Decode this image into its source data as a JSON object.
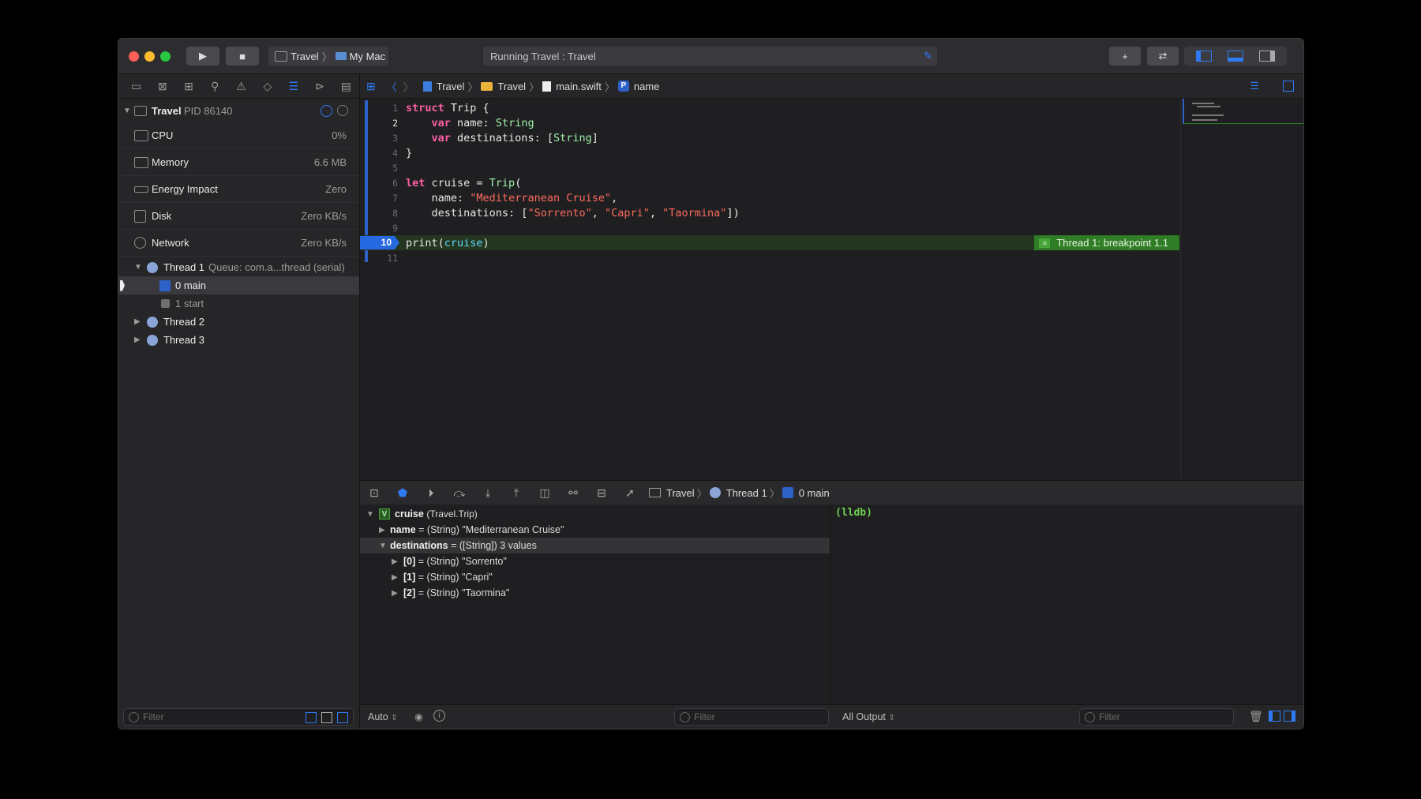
{
  "toolbar": {
    "scheme_project": "Travel",
    "scheme_destination": "My Mac",
    "status": "Running Travel : Travel"
  },
  "navigator": {
    "process_name": "Travel",
    "process_pid": "PID 86140",
    "gauges": [
      {
        "label": "CPU",
        "value": "0%"
      },
      {
        "label": "Memory",
        "value": "6.6 MB"
      },
      {
        "label": "Energy Impact",
        "value": "Zero"
      },
      {
        "label": "Disk",
        "value": "Zero KB/s"
      },
      {
        "label": "Network",
        "value": "Zero KB/s"
      }
    ],
    "thread1_label": "Thread 1",
    "thread1_queue": "Queue: com.a...thread (serial)",
    "frame0": "0 main",
    "frame1": "1 start",
    "thread2_label": "Thread 2",
    "thread3_label": "Thread 3",
    "filter_placeholder": "Filter"
  },
  "jumpbar": {
    "items": [
      "Travel",
      "Travel",
      "main.swift",
      "name"
    ]
  },
  "editor": {
    "line_numbers": [
      "1",
      "2",
      "3",
      "4",
      "5",
      "6",
      "7",
      "8",
      "9",
      "10",
      "11"
    ],
    "breakpoint_line": "10",
    "breakpoint_message": "Thread 1: breakpoint 1.1",
    "code": {
      "l1_kw": "struct",
      "l1_rest": " Trip {",
      "l2_kw": "var",
      "l2_name": " name: ",
      "l2_type": "String",
      "l3_kw": "var",
      "l3_name": " destinations: [",
      "l3_type": "String",
      "l3_end": "]",
      "l4": "}",
      "l6_kw": "let",
      "l6_name": " cruise = ",
      "l6_type": "Trip",
      "l6_end": "(",
      "l7_label": "name: ",
      "l7_str": "\"Mediterranean Cruise\"",
      "l7_end": ",",
      "l8_label": "destinations: [",
      "l8_s1": "\"Sorrento\"",
      "l8_c1": ", ",
      "l8_s2": "\"Capri\"",
      "l8_c2": ", ",
      "l8_s3": "\"Taormina\"",
      "l8_end": "])",
      "l10_fn": "print(",
      "l10_arg": "cruise",
      "l10_end": ")"
    }
  },
  "debugbar": {
    "path": [
      "Travel",
      "Thread 1",
      "0 main"
    ]
  },
  "variables": {
    "root_name": "cruise",
    "root_type": "(Travel.Trip)",
    "rows": [
      {
        "name": "name",
        "detail": "= (String) \"Mediterranean Cruise\""
      },
      {
        "name": "destinations",
        "detail": "= ([String]) 3 values"
      },
      {
        "name": "[0]",
        "detail": "= (String) \"Sorrento\""
      },
      {
        "name": "[1]",
        "detail": "= (String) \"Capri\""
      },
      {
        "name": "[2]",
        "detail": "= (String) \"Taormina\""
      }
    ]
  },
  "console": {
    "prompt": "(lldb)"
  },
  "bottom": {
    "auto_label": "Auto",
    "vars_filter": "Filter",
    "output_label": "All Output",
    "console_filter": "Filter"
  }
}
